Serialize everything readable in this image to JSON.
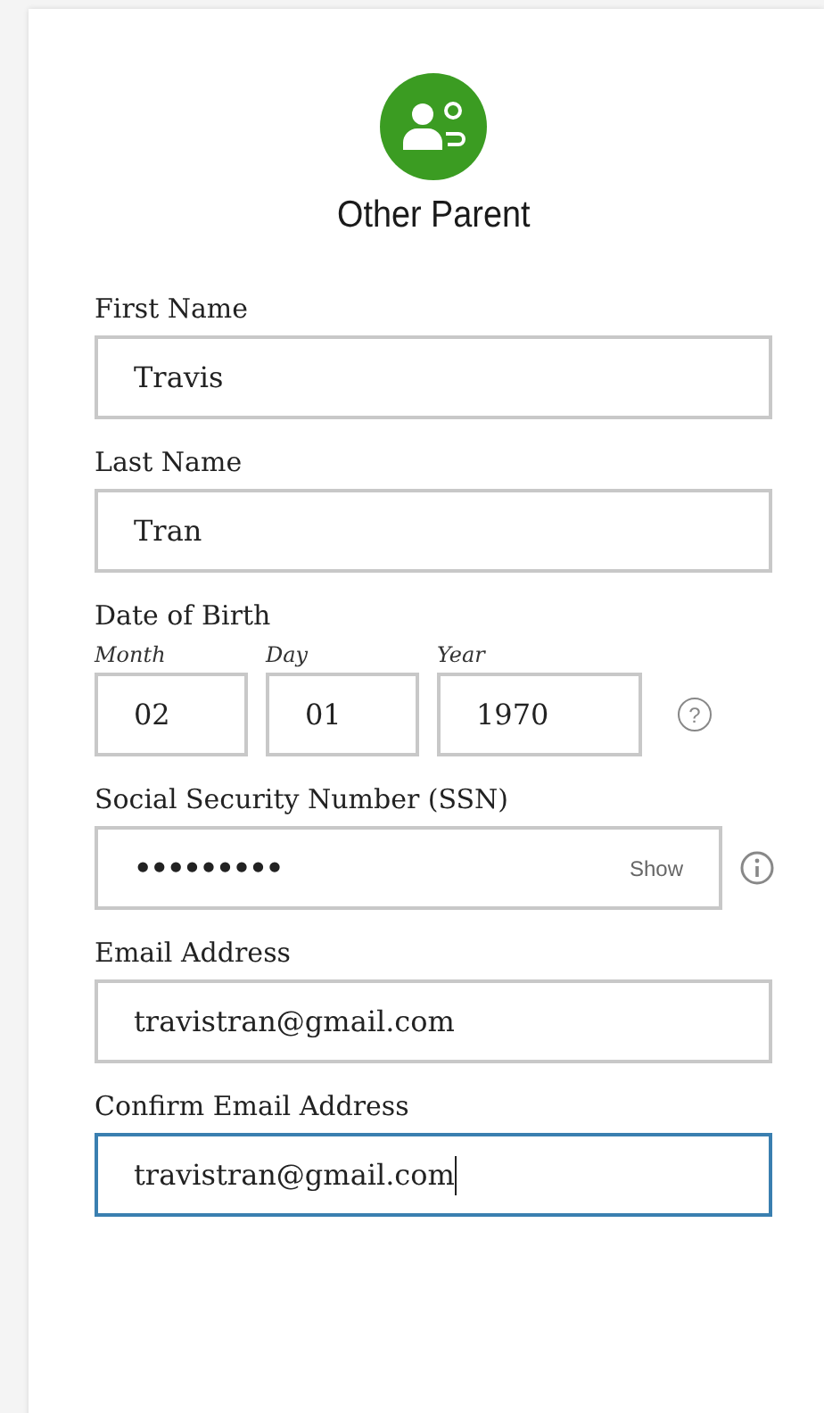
{
  "header": {
    "title": "Other Parent"
  },
  "fields": [
    {
      "kind": "text",
      "label": "First Name",
      "value": "Travis",
      "focused": false
    },
    {
      "kind": "text",
      "label": "Last Name",
      "value": "Tran",
      "focused": false
    },
    {
      "kind": "date",
      "label": "Date of Birth",
      "parts": [
        {
          "sublabel": "Month",
          "value": "02"
        },
        {
          "sublabel": "Day",
          "value": "01"
        },
        {
          "sublabel": "Year",
          "value": "1970"
        }
      ],
      "help": "?"
    },
    {
      "kind": "password",
      "label": "Social Security Number (SSN)",
      "value": "•••••••••",
      "toggle": "Show",
      "focused": false
    },
    {
      "kind": "text",
      "label": "Email Address",
      "value": "travistran@gmail.com",
      "focused": false
    },
    {
      "kind": "text",
      "label": "Confirm Email Address",
      "value": "travistran@gmail.com",
      "focused": true
    }
  ]
}
